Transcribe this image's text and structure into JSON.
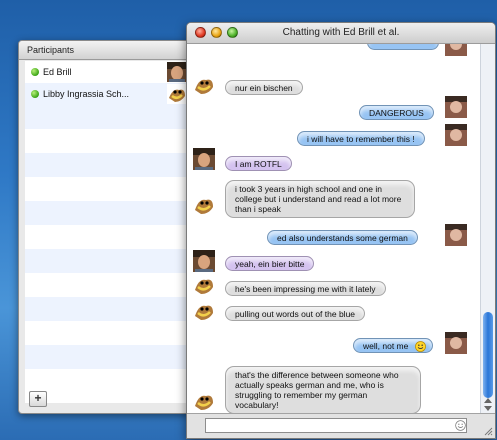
{
  "participants": {
    "title": "Participants",
    "items": [
      {
        "name": "Ed Brill",
        "avatar": "ed-photo"
      },
      {
        "name": "Libby Ingrassia Sch...",
        "avatar": "taz"
      }
    ],
    "add_label": "+"
  },
  "chat": {
    "title": "Chatting with Ed Brill et al.",
    "messages": [
      {
        "from": "other",
        "text": "nur ein bischen"
      },
      {
        "from": "me",
        "text": "DANGEROUS"
      },
      {
        "from": "me",
        "text": "i will have to remember this !"
      },
      {
        "from": "ed",
        "text": "I am ROTFL"
      },
      {
        "from": "other",
        "text": "i took 3 years in high school and one in college but i understand and read a lot more than i speak"
      },
      {
        "from": "me",
        "text": "ed also understands some german"
      },
      {
        "from": "ed",
        "text": "yeah, ein bier bitte"
      },
      {
        "from": "other",
        "text": "he's been impressing me with it lately"
      },
      {
        "from": "other",
        "text": "pulling out words out of the blue"
      },
      {
        "from": "me",
        "text": "well, not me"
      },
      {
        "from": "other",
        "text": "that's the difference between someone who actually speaks german and me, who is struggling to remember my german vocabulary!"
      }
    ],
    "input_value": ""
  }
}
